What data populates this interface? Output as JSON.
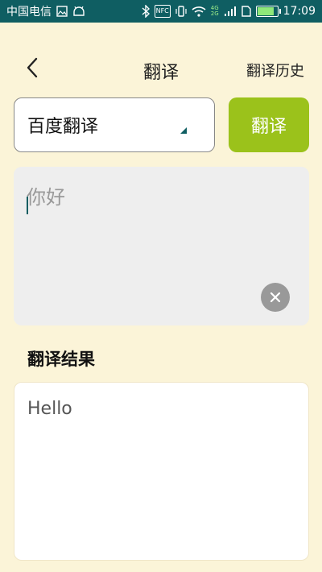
{
  "status_bar": {
    "carrier": "中国电信",
    "nfc_label": "NFC",
    "network_top": "4G",
    "network_bottom": "2G",
    "battery_level": 0.85,
    "time": "17:09"
  },
  "header": {
    "title": "翻译",
    "history_link": "翻译历史"
  },
  "engine_select": {
    "selected": "百度翻译"
  },
  "translate_button": {
    "label": "翻译"
  },
  "input": {
    "placeholder": "你好"
  },
  "result": {
    "label": "翻译结果",
    "text": "Hello"
  },
  "colors": {
    "status_bar": "#0f5e62",
    "background": "#fbf4d8",
    "accent_button": "#9bc21b"
  }
}
